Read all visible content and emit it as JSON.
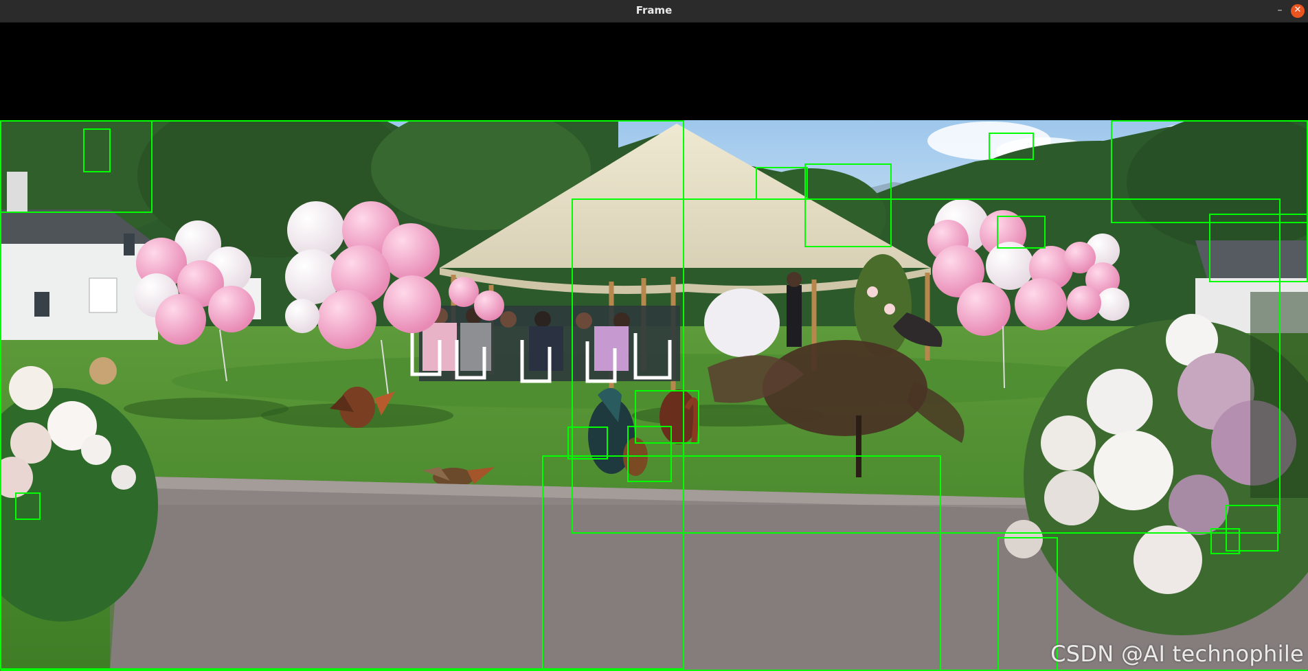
{
  "window": {
    "title": "Frame",
    "minimize_glyph": "–",
    "close_glyph": "✕",
    "close_color": "#e95420"
  },
  "watermark": "CSDN @AI technophile",
  "detection": {
    "box_color": "#00ff00",
    "box_count": 20
  },
  "scene_icon": "outdoor-wedding-scene-image"
}
